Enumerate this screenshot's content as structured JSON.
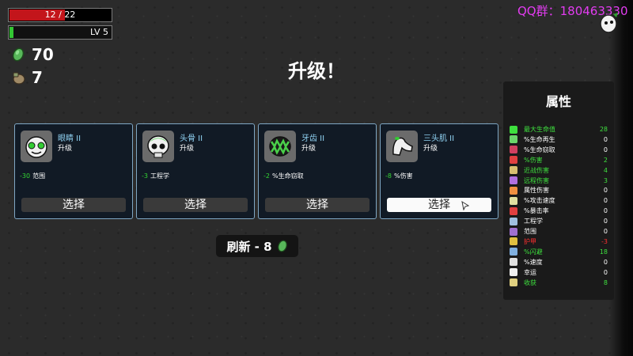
{
  "hud": {
    "hp_text": "12 / 22",
    "hp_fraction": 0.545,
    "level_text": "LV 5",
    "xp_fraction": 0.04,
    "materials": "70",
    "bag": "7"
  },
  "watermark": "QQ群：180463330",
  "title": "升级！",
  "cards": [
    {
      "name": "眼睛 II",
      "type": "升级",
      "stat_value": "-30",
      "stat_label": "范围",
      "button": "选择",
      "icon": "eye-icon"
    },
    {
      "name": "头骨 II",
      "type": "升级",
      "stat_value": "-3",
      "stat_label": "工程学",
      "button": "选择",
      "icon": "skull-icon"
    },
    {
      "name": "牙齿 II",
      "type": "升级",
      "stat_value": "-2",
      "stat_label": "%生命窃取",
      "button": "选择",
      "icon": "teeth-icon"
    },
    {
      "name": "三头肌 II",
      "type": "升级",
      "stat_value": "-8",
      "stat_label": "%伤害",
      "button": "选择",
      "icon": "triceps-icon"
    }
  ],
  "refresh": {
    "label": "刷新 - 8"
  },
  "stats_panel": {
    "title": "属性",
    "rows": [
      {
        "label": "最大生命值",
        "value": "28",
        "color": "green",
        "icon_color": "#3ee03e"
      },
      {
        "label": "%生命再生",
        "value": "0",
        "color": "white",
        "icon_color": "#6ad66a"
      },
      {
        "label": "%生命窃取",
        "value": "0",
        "color": "white",
        "icon_color": "#d04060"
      },
      {
        "label": "%伤害",
        "value": "2",
        "color": "green",
        "icon_color": "#e04040"
      },
      {
        "label": "近战伤害",
        "value": "4",
        "color": "green",
        "icon_color": "#d8c070"
      },
      {
        "label": "远程伤害",
        "value": "3",
        "color": "green",
        "icon_color": "#b070e0"
      },
      {
        "label": "属性伤害",
        "value": "0",
        "color": "white",
        "icon_color": "#f09040"
      },
      {
        "label": "%攻击速度",
        "value": "0",
        "color": "white",
        "icon_color": "#e0e0a0"
      },
      {
        "label": "%暴击率",
        "value": "0",
        "color": "white",
        "icon_color": "#e04040"
      },
      {
        "label": "工程学",
        "value": "0",
        "color": "white",
        "icon_color": "#a0c0e0"
      },
      {
        "label": "范围",
        "value": "0",
        "color": "white",
        "icon_color": "#a070d0"
      },
      {
        "label": "护甲",
        "value": "-3",
        "color": "red",
        "icon_color": "#e0c040"
      },
      {
        "label": "%闪避",
        "value": "18",
        "color": "green",
        "icon_color": "#80b0e0"
      },
      {
        "label": "%速度",
        "value": "0",
        "color": "white",
        "icon_color": "#e0e0e0"
      },
      {
        "label": "幸运",
        "value": "0",
        "color": "white",
        "icon_color": "#f0f0f0"
      },
      {
        "label": "收获",
        "value": "8",
        "color": "green",
        "icon_color": "#e0d080"
      }
    ]
  }
}
